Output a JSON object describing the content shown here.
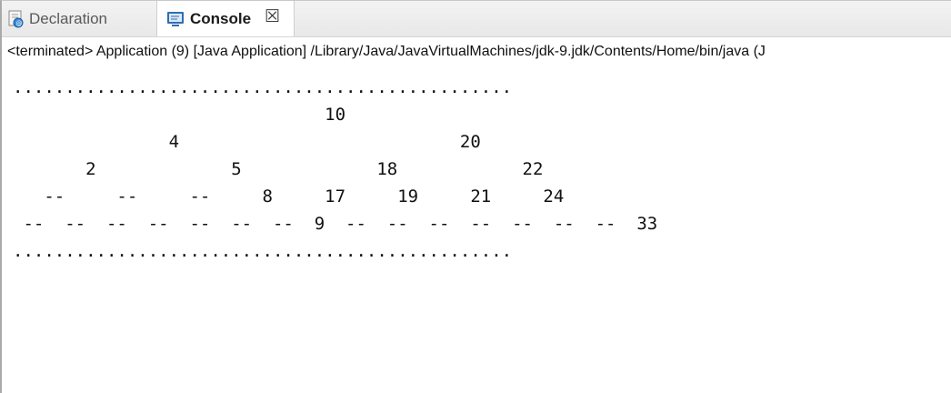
{
  "tabs": [
    {
      "label": "Declaration",
      "icon": "declaration-icon",
      "active": false
    },
    {
      "label": "Console",
      "icon": "console-icon",
      "active": true,
      "close_icon": "close-icon",
      "close_glyph": "☒"
    }
  ],
  "status_line": "<terminated> Application (9) [Java Application] /Library/Java/JavaVirtualMachines/jdk-9.jdk/Contents/Home/bin/java (J",
  "console": {
    "lines": [
      "................................................",
      "                              10",
      "               4                           20",
      "       2             5             18            22",
      "   --     --     --     8     17     19     21     24",
      " --  --  --  --  --  --  --  9  --  --  --  --  --  --  --  33",
      "................................................"
    ]
  },
  "colors": {
    "accent": "#2f6db3",
    "tab_bar_bg": "#ededed",
    "text": "#111111"
  }
}
